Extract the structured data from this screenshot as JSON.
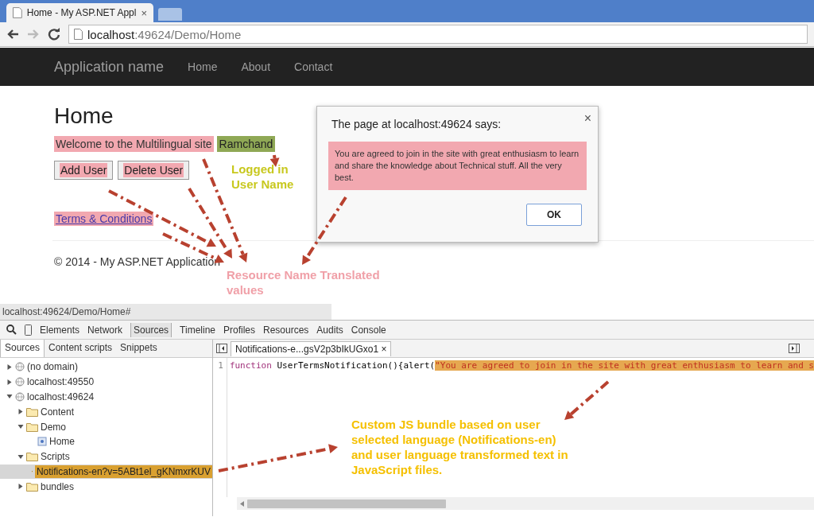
{
  "browser": {
    "tab_title": "Home - My ASP.NET Appl",
    "tab_close": "×",
    "url_host": "localhost",
    "url_path": ":49624/Demo/Home"
  },
  "navbar": {
    "brand": "Application name",
    "links": [
      "Home",
      "About",
      "Contact"
    ]
  },
  "page": {
    "heading": "Home",
    "welcome": "Welcome to the Multilingual site",
    "user": "Ramchand",
    "buttons": [
      "Add User",
      "Delete User"
    ],
    "link": "Terms & Conditions",
    "footer": "© 2014 - My ASP.NET Application"
  },
  "dialog": {
    "title": "The page at localhost:49624 says:",
    "close": "×",
    "message": "You are agreed to join in the site with great enthusiasm to learn and share the knowledge about Technical stuff. All the very best.",
    "ok": "OK"
  },
  "status_url": "localhost:49624/Demo/Home#",
  "devtools": {
    "tabs": [
      {
        "label": "Elements",
        "selected": false
      },
      {
        "label": "Network",
        "selected": false
      },
      {
        "label": "Sources",
        "selected": true
      },
      {
        "label": "Timeline",
        "selected": false
      },
      {
        "label": "Profiles",
        "selected": false
      },
      {
        "label": "Resources",
        "selected": false
      },
      {
        "label": "Audits",
        "selected": false
      },
      {
        "label": "Console",
        "selected": false
      }
    ],
    "navigator_tabs": [
      {
        "label": "Sources",
        "selected": true
      },
      {
        "label": "Content scripts",
        "selected": false
      },
      {
        "label": "Snippets",
        "selected": false
      }
    ],
    "tree": [
      {
        "kind": "domain",
        "label": "(no domain)",
        "expanded": false,
        "selected": false
      },
      {
        "kind": "domain",
        "label": "localhost:49550",
        "expanded": false,
        "selected": false
      },
      {
        "kind": "domain",
        "label": "localhost:49624",
        "expanded": true,
        "selected": false,
        "children": [
          {
            "kind": "folder",
            "label": "Content",
            "expanded": false,
            "selected": false
          },
          {
            "kind": "folder",
            "label": "Demo",
            "expanded": true,
            "selected": false,
            "children": [
              {
                "kind": "page",
                "label": "Home",
                "selected": false
              }
            ]
          },
          {
            "kind": "folder",
            "label": "Scripts",
            "expanded": true,
            "selected": false,
            "children": [
              {
                "kind": "file",
                "label": "Notifications-en?v=5ABt1el_gKNmxrKUV",
                "selected": true
              }
            ]
          },
          {
            "kind": "folder",
            "label": "bundles",
            "expanded": false,
            "selected": false
          }
        ]
      }
    ],
    "editor": {
      "tab": "Notifications-e...gsV2p3bIkUGxo1",
      "tab_close": "×",
      "line_number": "1",
      "keyword": "function",
      "code": " UserTermsNotification(){alert(",
      "string": "\"You are agreed to join in the site with great enthusiasm to learn and s"
    }
  },
  "annotations": [
    {
      "text": "Logged in User Name",
      "color": "#c8c81e"
    },
    {
      "text": "Resource Name Translated values",
      "color": "#f0a0a8"
    },
    {
      "text": "Custom JS bundle based on user selected language (Notifications-en) and user language transformed text in JavaScript files.",
      "color": "#f5c000"
    }
  ]
}
